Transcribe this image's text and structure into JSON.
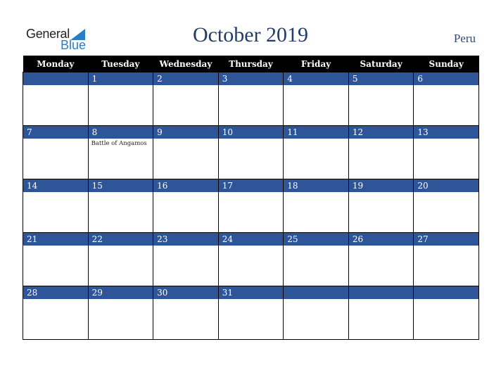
{
  "logo": {
    "general": "General",
    "blue": "Blue"
  },
  "title": "October 2019",
  "country": "Peru",
  "weekdays": [
    "Monday",
    "Tuesday",
    "Wednesday",
    "Thursday",
    "Friday",
    "Saturday",
    "Sunday"
  ],
  "colors": {
    "band": "#2d5597",
    "header": "#000000",
    "title": "#233c6a"
  },
  "weeks": [
    [
      {
        "day": ""
      },
      {
        "day": "1"
      },
      {
        "day": "2"
      },
      {
        "day": "3"
      },
      {
        "day": "4"
      },
      {
        "day": "5"
      },
      {
        "day": "6"
      }
    ],
    [
      {
        "day": "7"
      },
      {
        "day": "8",
        "event": "Battle of Angamos"
      },
      {
        "day": "9"
      },
      {
        "day": "10"
      },
      {
        "day": "11"
      },
      {
        "day": "12"
      },
      {
        "day": "13"
      }
    ],
    [
      {
        "day": "14"
      },
      {
        "day": "15"
      },
      {
        "day": "16"
      },
      {
        "day": "17"
      },
      {
        "day": "18"
      },
      {
        "day": "19"
      },
      {
        "day": "20"
      }
    ],
    [
      {
        "day": "21"
      },
      {
        "day": "22"
      },
      {
        "day": "23"
      },
      {
        "day": "24"
      },
      {
        "day": "25"
      },
      {
        "day": "26"
      },
      {
        "day": "27"
      }
    ],
    [
      {
        "day": "28"
      },
      {
        "day": "29"
      },
      {
        "day": "30"
      },
      {
        "day": "31"
      },
      {
        "day": ""
      },
      {
        "day": ""
      },
      {
        "day": ""
      }
    ]
  ]
}
